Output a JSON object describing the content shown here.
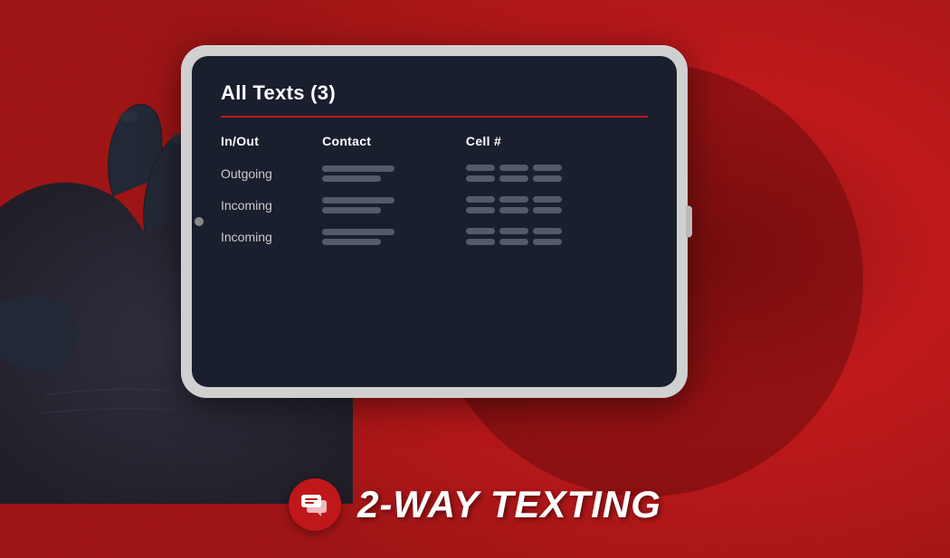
{
  "background": {
    "color": "#c0171a"
  },
  "tablet": {
    "screen": {
      "title": "All Texts (3)",
      "divider_color": "#c0171a",
      "table": {
        "headers": [
          "In/Out",
          "Contact",
          "Cell #"
        ],
        "rows": [
          {
            "inout": "Outgoing",
            "contact_bars": [
              "wide",
              "medium"
            ],
            "cell_segments": 6
          },
          {
            "inout": "Incoming",
            "contact_bars": [
              "wide",
              "medium"
            ],
            "cell_segments": 6
          },
          {
            "inout": "Incoming",
            "contact_bars": [
              "wide",
              "medium"
            ],
            "cell_segments": 6
          }
        ]
      }
    }
  },
  "bottom": {
    "title": "2-WAY TEXTING",
    "icon": "chat-bubbles"
  }
}
